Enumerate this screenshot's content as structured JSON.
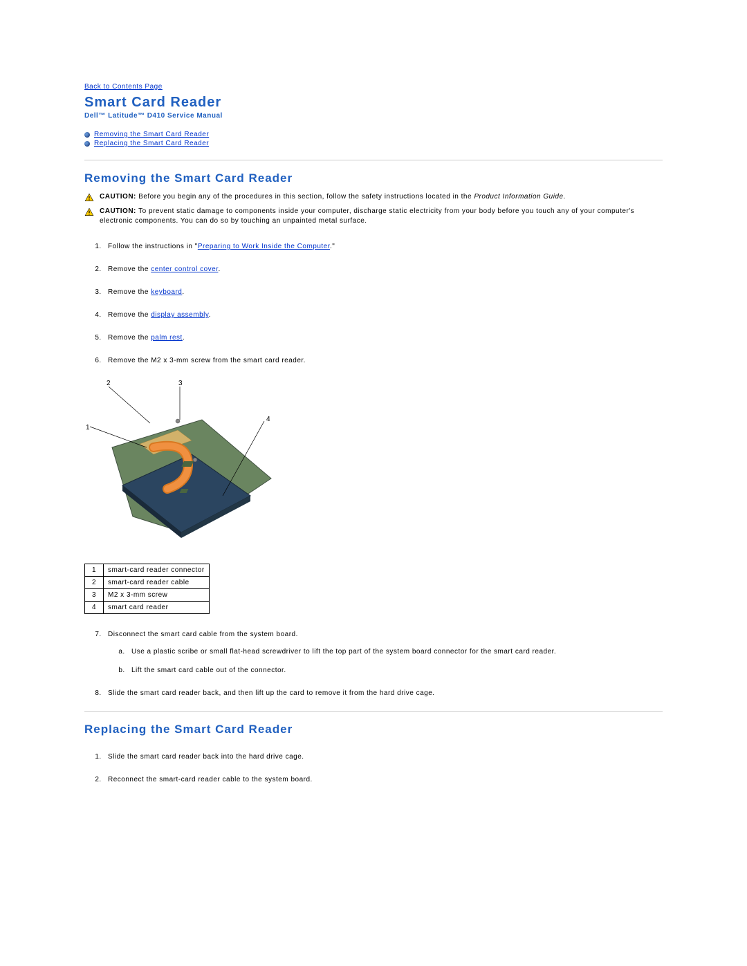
{
  "nav": {
    "back_link": "Back to Contents Page"
  },
  "header": {
    "title": "Smart Card Reader",
    "subtitle": "Dell™ Latitude™ D410 Service Manual"
  },
  "toc": {
    "item1": "Removing the Smart Card Reader",
    "item2": "Replacing the Smart Card Reader"
  },
  "removing": {
    "title": "Removing the Smart Card Reader",
    "caution1": {
      "label": "CAUTION: ",
      "text_a": "Before you begin any of the procedures in this section, follow the safety instructions located in the ",
      "text_italic": "Product Information Guide",
      "text_b": "."
    },
    "caution2": {
      "label": "CAUTION: ",
      "text": "To prevent static damage to components inside your computer, discharge static electricity from your body before you touch any of your computer's electronic components. You can do so by touching an unpainted metal surface."
    },
    "step1_a": "Follow the instructions in \"",
    "step1_link": "Preparing to Work Inside the Computer",
    "step1_b": ".\"",
    "step2_a": "Remove the ",
    "step2_link": "center control cover",
    "step2_b": ".",
    "step3_a": "Remove the ",
    "step3_link": "keyboard",
    "step3_b": ".",
    "step4_a": "Remove the ",
    "step4_link": "display assembly",
    "step4_b": ".",
    "step5_a": "Remove the ",
    "step5_link": "palm rest",
    "step5_b": ".",
    "step6": "Remove the M2 x 3-mm screw from the smart card reader.",
    "callout1": "1",
    "callout2": "2",
    "callout3": "3",
    "callout4": "4",
    "legend": {
      "r1n": "1",
      "r1t": "smart-card reader connector",
      "r2n": "2",
      "r2t": "smart-card reader cable",
      "r3n": "3",
      "r3t": "M2 x 3-mm screw",
      "r4n": "4",
      "r4t": "smart card reader"
    },
    "step7": "Disconnect the smart card cable from the system board.",
    "step7a": "Use a plastic scribe or small flat-head screwdriver to lift the top part of the system board connector for the smart card reader.",
    "step7b": "Lift the smart card cable out of the connector.",
    "step8": "Slide the smart card reader back, and then lift up the card to remove it from the hard drive cage."
  },
  "replacing": {
    "title": "Replacing the Smart Card Reader",
    "step1": "Slide the smart card reader back into the hard drive cage.",
    "step2": "Reconnect the smart-card reader cable to the system board."
  }
}
